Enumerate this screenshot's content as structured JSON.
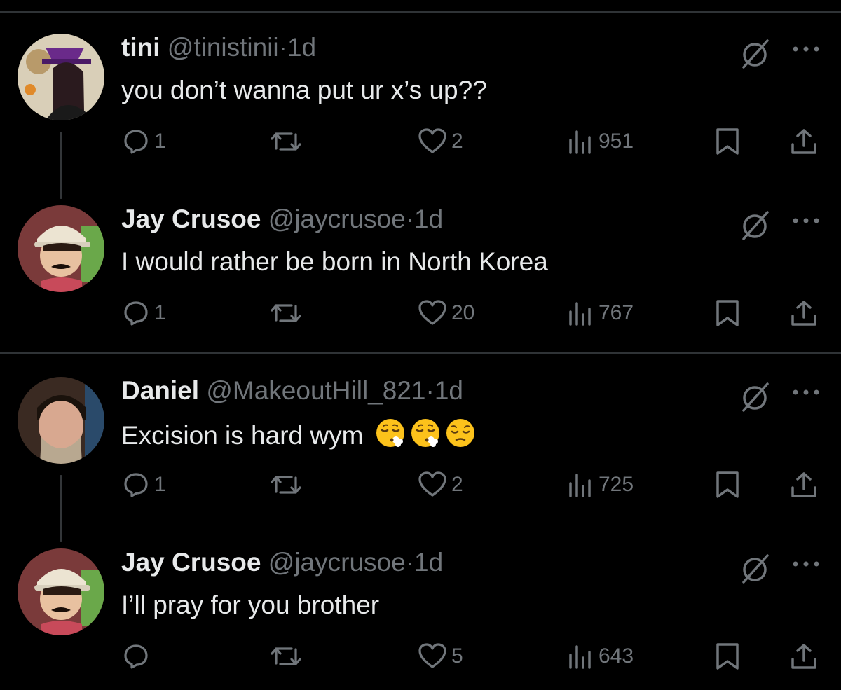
{
  "tweets": [
    {
      "name": "tini",
      "handle": "@tinistinii",
      "dot": "·",
      "time": "1d",
      "text": "you don’t wanna put ur x’s up??",
      "replies": "1",
      "reposts": "",
      "likes": "2",
      "views": "951"
    },
    {
      "name": "Jay Crusoe",
      "handle": "@jaycrusoe",
      "dot": "·",
      "time": "1d",
      "text": "I would rather be born in North Korea",
      "replies": "1",
      "reposts": "",
      "likes": "20",
      "views": "767"
    },
    {
      "name": "Daniel",
      "handle": "@MakeoutHill_821",
      "dot": "·",
      "time": "1d",
      "text": "Excision is hard wym",
      "emojis": [
        "face-exhaling-emoji",
        "face-exhaling-emoji",
        "pensive-face-emoji"
      ],
      "replies": "1",
      "reposts": "",
      "likes": "2",
      "views": "725"
    },
    {
      "name": "Jay Crusoe",
      "handle": "@jaycrusoe",
      "dot": "·",
      "time": "1d",
      "text": "I’ll pray for you brother",
      "replies": "",
      "reposts": "",
      "likes": "5",
      "views": "643"
    }
  ],
  "colors": {
    "background": "#000000",
    "text": "#e7e9ea",
    "secondary": "#71767b",
    "divider": "#2f3336"
  }
}
